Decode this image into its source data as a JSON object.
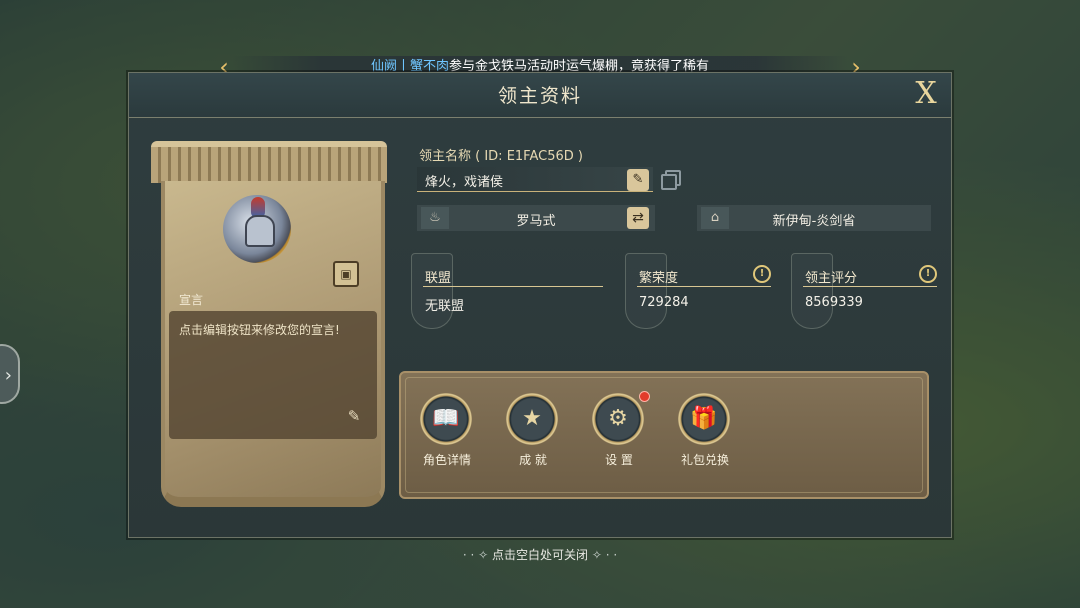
{
  "ticker": {
    "highlight": "仙阙丨蟹不肉",
    "message": "参与金戈铁马活动时运气爆棚，竟获得了稀有"
  },
  "panel": {
    "title": "领主资料",
    "close_label": "X"
  },
  "card": {
    "motto_label": "宣言",
    "motto_text": "点击编辑按钮来修改您的宣言!"
  },
  "lord": {
    "id_label": "领主名称 ( ID: E1FAC56D )",
    "name": "烽火，戏诸侯",
    "civilization": "罗马式",
    "location": "新伊甸-炎剑省"
  },
  "stats": [
    {
      "title": "联盟",
      "value": "无联盟",
      "has_info": false
    },
    {
      "title": "繁荣度",
      "value": "729284",
      "has_info": true
    },
    {
      "title": "领主评分",
      "value": "8569339",
      "has_info": true
    }
  ],
  "actions": [
    {
      "label": "角色详情",
      "icon": "book-icon",
      "badge": false
    },
    {
      "label": "成 就",
      "icon": "trophy-icon",
      "badge": false
    },
    {
      "label": "设 置",
      "icon": "gear-icon",
      "badge": true
    },
    {
      "label": "礼包兑换",
      "icon": "gift-icon",
      "badge": false
    }
  ],
  "footer": {
    "hint": "点击空白处可关闭"
  },
  "colors": {
    "accent": "#d9c69b",
    "badge": "#e23b2b",
    "highlight": "#6fc6ff"
  }
}
